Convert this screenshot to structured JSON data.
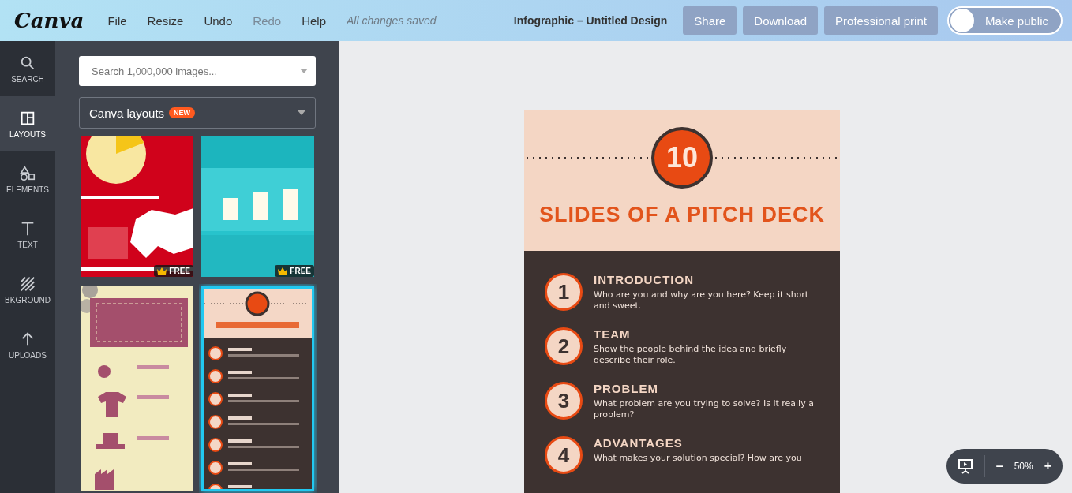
{
  "topbar": {
    "logo": "Canva",
    "menu": [
      {
        "label": "File",
        "disabled": false
      },
      {
        "label": "Resize",
        "disabled": false
      },
      {
        "label": "Undo",
        "disabled": false
      },
      {
        "label": "Redo",
        "disabled": true
      },
      {
        "label": "Help",
        "disabled": false
      }
    ],
    "status": "All changes saved",
    "document_title": "Infographic – Untitled Design",
    "buttons": [
      "Share",
      "Download",
      "Professional print"
    ],
    "toggle": {
      "label": "Make public",
      "on": false
    }
  },
  "sidebar": {
    "items": [
      {
        "label": "SEARCH",
        "selected": false
      },
      {
        "label": "LAYOUTS",
        "selected": true
      },
      {
        "label": "ELEMENTS",
        "selected": false
      },
      {
        "label": "TEXT",
        "selected": false
      },
      {
        "label": "BKGROUND",
        "selected": false
      },
      {
        "label": "UPLOADS",
        "selected": false
      }
    ]
  },
  "panel": {
    "search": {
      "placeholder": "Search 1,000,000 images..."
    },
    "dropdown": {
      "value": "Canva layouts",
      "badge": "NEW"
    },
    "thumbnails": [
      {
        "kind": "picture",
        "badge": "FREE",
        "selected": false
      },
      {
        "kind": "picture",
        "badge": "FREE",
        "selected": false
      },
      {
        "kind": "picture",
        "selected": false
      },
      {
        "kind": "picture",
        "selected": true
      }
    ]
  },
  "design": {
    "badge": "10",
    "title": "SLIDES OF A PITCH DECK",
    "items": [
      {
        "number": "1",
        "heading": "INTRODUCTION",
        "text": "Who are you and why are you here? Keep it short and sweet."
      },
      {
        "number": "2",
        "heading": "TEAM",
        "text": "Show the people behind the idea and briefly describe their role."
      },
      {
        "number": "3",
        "heading": "PROBLEM",
        "text": "What problem are you trying to solve? Is it really a problem?"
      },
      {
        "number": "4",
        "heading": "ADVANTAGES",
        "text": "What makes your solution special? How are you"
      }
    ]
  },
  "zoom": {
    "minus": "–",
    "value": "50%",
    "plus": "+"
  }
}
